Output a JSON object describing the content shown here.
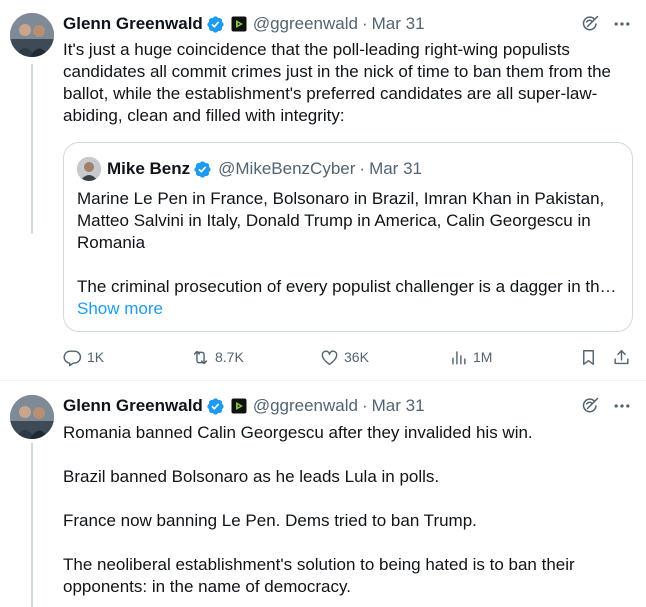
{
  "tweet1": {
    "author_name": "Glenn Greenwald",
    "handle": "@ggreenwald",
    "separator": "·",
    "date": "Mar 31",
    "text": "It's just a huge coincidence that the poll-leading right-wing populists candidates all commit crimes just in the nick of time to ban them from the ballot, while the establishment's preferred candidates are all super-law-abiding, clean and filled with integrity:",
    "quote": {
      "author_name": "Mike Benz",
      "handle": "@MikeBenzCyber",
      "separator": "·",
      "date": "Mar 31",
      "text": "Marine Le Pen in France, Bolsonaro in Brazil, Imran Khan in Pakistan, Matteo Salvini in Italy, Donald Trump in America, Calin Georgescu in Romania",
      "text2": "The criminal prosecution of every populist challenger is a dagger in th…",
      "show_more": "Show more"
    },
    "stats": {
      "replies": "1K",
      "reposts": "8.7K",
      "likes": "36K",
      "views": "1M"
    }
  },
  "tweet2": {
    "author_name": "Glenn Greenwald",
    "handle": "@ggreenwald",
    "separator": "·",
    "date": "Mar 31",
    "text": "Romania banned Calin Georgescu after they invalided his win.\n\nBrazil banned Bolsonaro as he leads Lula in polls.\n\nFrance now banning Le Pen. Dems tried to ban Trump.\n\nThe neoliberal establishment's solution to being hated is to ban their opponents: in the name of democracy."
  },
  "icons": {
    "verified": "verified-badge-icon",
    "affiliation": "rumble-affiliate-icon",
    "grok": "grok-icon",
    "more": "more-icon",
    "reply": "reply-icon",
    "repost": "repost-icon",
    "like": "heart-icon",
    "views": "views-icon",
    "bookmark": "bookmark-icon",
    "share": "share-icon"
  },
  "colors": {
    "text": "#0f1419",
    "secondary": "#536471",
    "link": "#1d9bf0",
    "verified": "#1d9bf0",
    "border": "#cfd9de"
  }
}
